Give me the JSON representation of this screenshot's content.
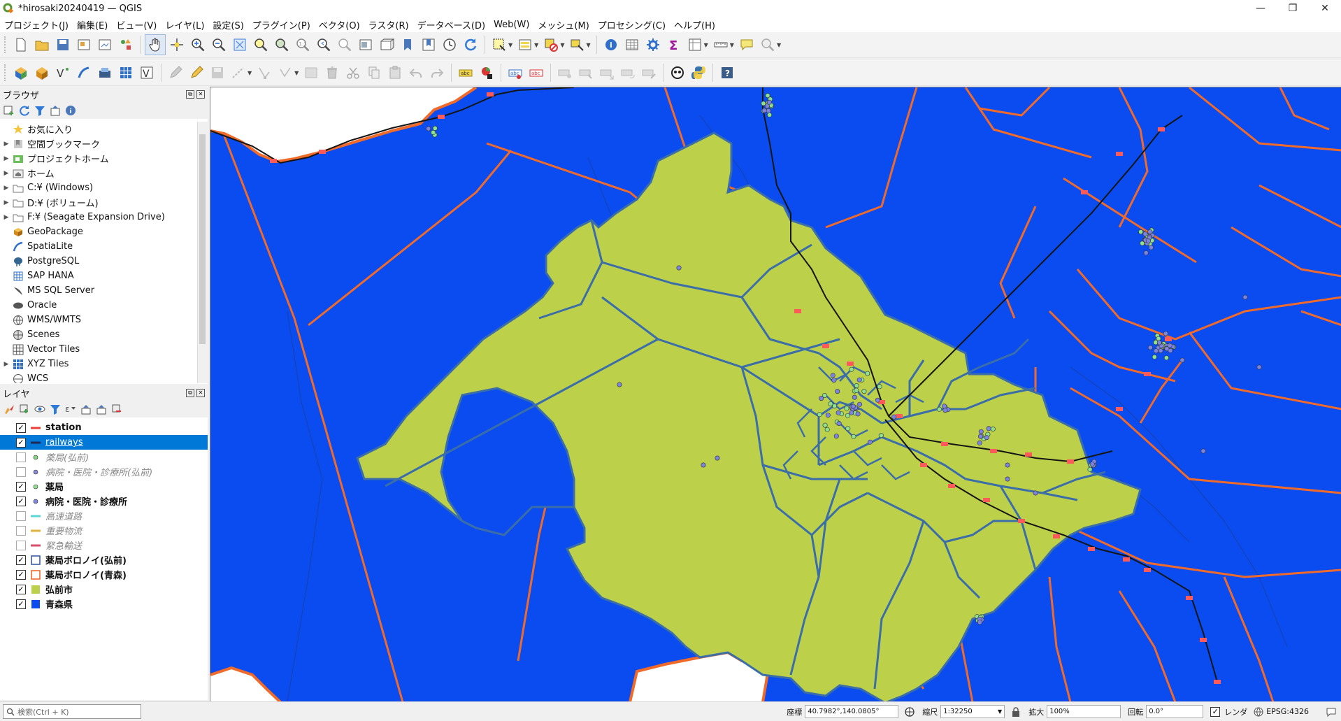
{
  "window": {
    "title": "*hirosaki20240419 — QGIS",
    "controls": [
      "—",
      "❐",
      "✕"
    ]
  },
  "menubar": [
    "プロジェクト(J)",
    "編集(E)",
    "ビュー(V)",
    "レイヤ(L)",
    "設定(S)",
    "プラグイン(P)",
    "ベクタ(O)",
    "ラスタ(R)",
    "データベース(D)",
    "Web(W)",
    "メッシュ(M)",
    "プロセシング(C)",
    "ヘルプ(H)"
  ],
  "browser_panel": {
    "title": "ブラウザ",
    "items": [
      {
        "label": "お気に入り",
        "icon": "star-icon",
        "expandable": false
      },
      {
        "label": "空間ブックマーク",
        "icon": "bookmark-icon",
        "expandable": true
      },
      {
        "label": "プロジェクトホーム",
        "icon": "project-home-icon",
        "expandable": true
      },
      {
        "label": "ホーム",
        "icon": "home-folder-icon",
        "expandable": true
      },
      {
        "label": "C:¥ (Windows)",
        "icon": "drive-icon",
        "expandable": true
      },
      {
        "label": "D:¥ (ボリューム)",
        "icon": "drive-icon",
        "expandable": true
      },
      {
        "label": "F:¥ (Seagate Expansion Drive)",
        "icon": "drive-icon",
        "expandable": true
      },
      {
        "label": "GeoPackage",
        "icon": "geopackage-icon",
        "expandable": false
      },
      {
        "label": "SpatiaLite",
        "icon": "spatialite-icon",
        "expandable": false
      },
      {
        "label": "PostgreSQL",
        "icon": "postgresql-icon",
        "expandable": false
      },
      {
        "label": "SAP HANA",
        "icon": "sap-hana-icon",
        "expandable": false
      },
      {
        "label": "MS SQL Server",
        "icon": "mssql-icon",
        "expandable": false
      },
      {
        "label": "Oracle",
        "icon": "oracle-icon",
        "expandable": false
      },
      {
        "label": "WMS/WMTS",
        "icon": "wms-icon",
        "expandable": false
      },
      {
        "label": "Scenes",
        "icon": "scenes-icon",
        "expandable": false
      },
      {
        "label": "Vector Tiles",
        "icon": "vector-tiles-icon",
        "expandable": false
      },
      {
        "label": "XYZ Tiles",
        "icon": "xyz-tiles-icon",
        "expandable": true
      },
      {
        "label": "WCS",
        "icon": "wcs-icon",
        "expandable": false
      }
    ]
  },
  "layers_panel": {
    "title": "レイヤ",
    "layers": [
      {
        "name": "station",
        "checked": true,
        "state": "active",
        "symbol": "line",
        "color": "#e8403a"
      },
      {
        "name": "railways",
        "checked": true,
        "state": "selected",
        "symbol": "line",
        "color": "#1c2a55"
      },
      {
        "name": "薬局(弘前)",
        "checked": false,
        "state": "inactive",
        "symbol": "point",
        "color": "#7fd67f"
      },
      {
        "name": "病院・医院・診療所(弘前)",
        "checked": false,
        "state": "inactive",
        "symbol": "point",
        "color": "#8a8ad8"
      },
      {
        "name": "薬局",
        "checked": true,
        "state": "active",
        "symbol": "point",
        "color": "#8fe08f"
      },
      {
        "name": "病院・医院・診療所",
        "checked": true,
        "state": "active",
        "symbol": "point",
        "color": "#7c84e0"
      },
      {
        "name": "高速道路",
        "checked": false,
        "state": "inactive",
        "symbol": "line",
        "color": "#5ed6d6"
      },
      {
        "name": "重要物流",
        "checked": false,
        "state": "inactive",
        "symbol": "line",
        "color": "#e3b23c"
      },
      {
        "name": "緊急輸送",
        "checked": false,
        "state": "inactive",
        "symbol": "line",
        "color": "#d9506a"
      },
      {
        "name": "薬局ボロノイ(弘前)",
        "checked": true,
        "state": "active",
        "symbol": "polygon-outline",
        "color": "#3b5ea0"
      },
      {
        "name": "薬局ボロノイ(青森)",
        "checked": true,
        "state": "active",
        "symbol": "polygon-outline",
        "color": "#f06a2a"
      },
      {
        "name": "弘前市",
        "checked": true,
        "state": "active",
        "symbol": "polygon-fill",
        "color": "#bdd04a"
      },
      {
        "name": "青森県",
        "checked": true,
        "state": "active",
        "symbol": "polygon-fill",
        "color": "#0a4cf0"
      }
    ]
  },
  "map_colors": {
    "aomori_fill": "#0a4cf0",
    "hirosaki_fill": "#bdd04a",
    "hirosaki_voronoi": "#3b6ea8",
    "aomori_voronoi": "#f06a2a",
    "railway": "#151515",
    "station": "#ff5a5a"
  },
  "statusbar": {
    "search_placeholder": "検索(Ctrl + K)",
    "coord_label": "座標",
    "coord_value": "40.7982°,140.0805°",
    "scale_label": "縮尺",
    "scale_value": "1:32250",
    "magnifier_label": "拡大",
    "magnifier_value": "100%",
    "rotation_label": "回転",
    "rotation_value": "0.0°",
    "render_label": "レンダ",
    "crs": "EPSG:4326"
  }
}
